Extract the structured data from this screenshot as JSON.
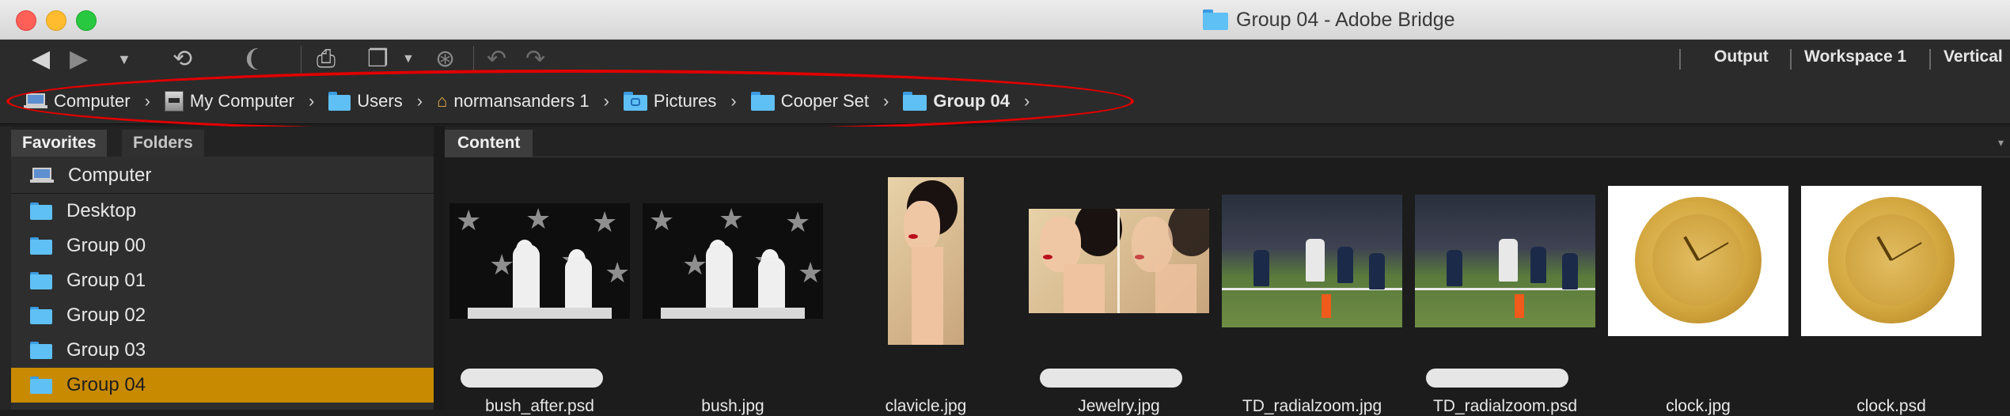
{
  "window": {
    "title": "Group 04 - Adobe Bridge",
    "traffic_lights": [
      "close",
      "minimize",
      "zoom"
    ]
  },
  "toolbar": {
    "icons": [
      "back-arrow-icon",
      "forward-arrow-icon",
      "history-dropdown-icon",
      "boomerang-return-icon",
      "reveal-icon",
      "get-photos-camera-icon",
      "refine-copy-icon",
      "camera-raw-icon",
      "rotate-left-icon",
      "rotate-right-icon"
    ],
    "workspaces": [
      "Output",
      "Workspace 1",
      "Vertical"
    ]
  },
  "path": {
    "items": [
      {
        "label": "Computer",
        "icon": "computer-icon"
      },
      {
        "label": "My Computer",
        "icon": "hard-drive-icon"
      },
      {
        "label": "Users",
        "icon": "users-folder-icon"
      },
      {
        "label": "normansanders 1",
        "icon": "home-icon"
      },
      {
        "label": "Pictures",
        "icon": "pictures-folder-icon"
      },
      {
        "label": "Cooper Set",
        "icon": "folder-icon"
      },
      {
        "label": "Group 04",
        "icon": "folder-icon"
      }
    ],
    "trailing": "›"
  },
  "leftpanel": {
    "tabs": [
      "Favorites",
      "Folders"
    ],
    "active_tab": "Favorites",
    "favorites": [
      {
        "label": "Computer",
        "icon": "computer-icon"
      },
      {
        "label": "Desktop",
        "icon": "folder-icon"
      },
      {
        "label": "Group 00",
        "icon": "folder-icon"
      },
      {
        "label": "Group 01",
        "icon": "folder-icon"
      },
      {
        "label": "Group 02",
        "icon": "folder-icon"
      },
      {
        "label": "Group 03",
        "icon": "folder-icon"
      },
      {
        "label": "Group 04",
        "icon": "folder-icon"
      }
    ],
    "selected": "Group 04"
  },
  "content": {
    "tab": "Content",
    "files": [
      {
        "name": "bush_after.psd",
        "label_pill": true
      },
      {
        "name": "bush.jpg",
        "label_pill": false
      },
      {
        "name": "clavicle.jpg",
        "label_pill": false
      },
      {
        "name": "Jewelry.jpg",
        "label_pill": true
      },
      {
        "name": "TD_radialzoom.jpg",
        "label_pill": false
      },
      {
        "name": "TD_radialzoom.psd",
        "label_pill": true
      },
      {
        "name": "clock.jpg",
        "label_pill": false
      },
      {
        "name": "clock.psd",
        "label_pill": false
      }
    ]
  },
  "colors": {
    "selection": "#c88a00",
    "folder_blue": "#4fb3f0",
    "highlight_annotation": "#e00000",
    "panel_bg": "#2e2e2e"
  }
}
